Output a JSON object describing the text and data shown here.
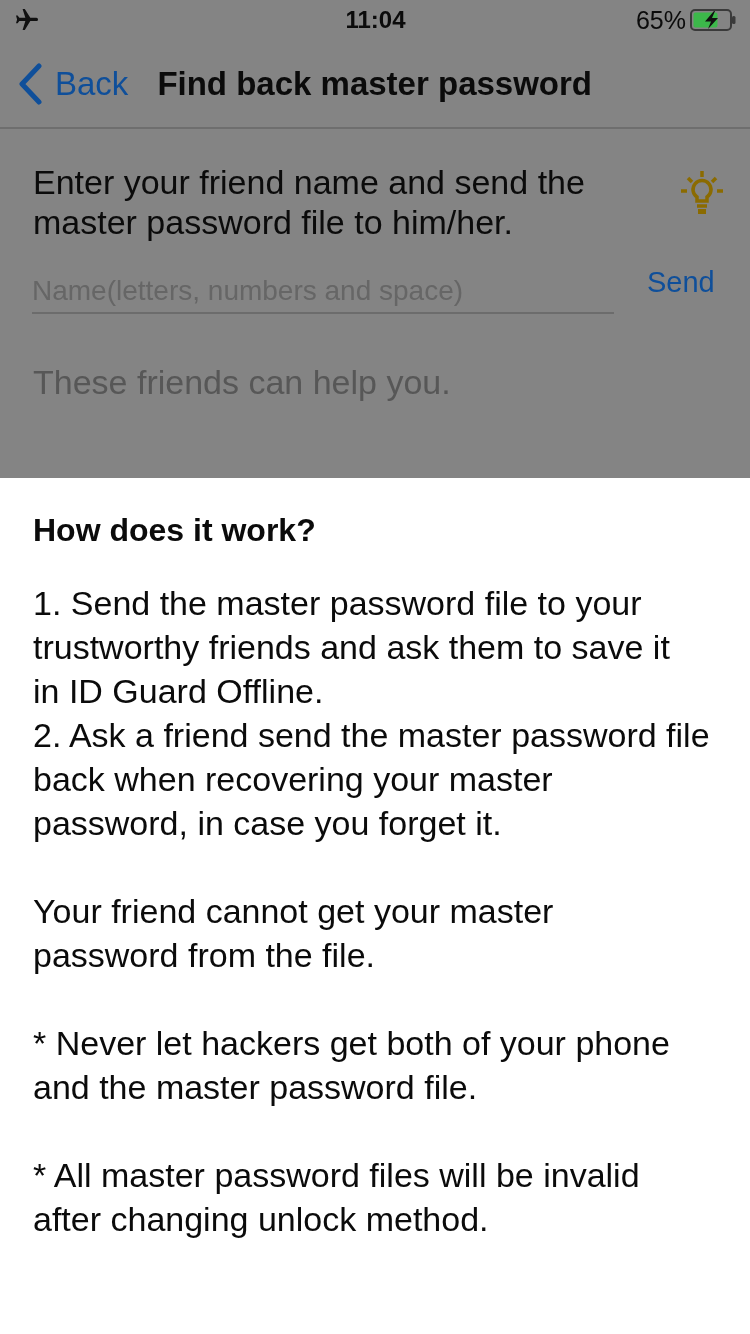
{
  "status_bar": {
    "time": "11:04",
    "battery": "65%"
  },
  "nav_bar": {
    "back": "Back",
    "title": "Find back master password"
  },
  "intro": "Enter your friend name and send the master password file to him/her.",
  "name_field": {
    "placeholder": "Name(letters, numbers and space)"
  },
  "send_button": "Send",
  "friends_label": "These friends can help you.",
  "sheet": {
    "title": "How does it work?",
    "paragraphs": [
      {
        "lines": [
          "1. Send the master password file to your\ntrustworthy friends and ask them to save it\nin ID Guard Offline.",
          "2. Ask a friend send the master password file\nback when recovering your master\npassword, in case you forget it."
        ]
      },
      {
        "lines": [
          "Your friend cannot get your master\npassword from the file."
        ]
      },
      {
        "lines": [
          "* Never let hackers get both of your phone\nand the master password file."
        ]
      },
      {
        "lines": [
          "* All master password files will be invalid\nafter changing unlock method."
        ]
      }
    ]
  }
}
